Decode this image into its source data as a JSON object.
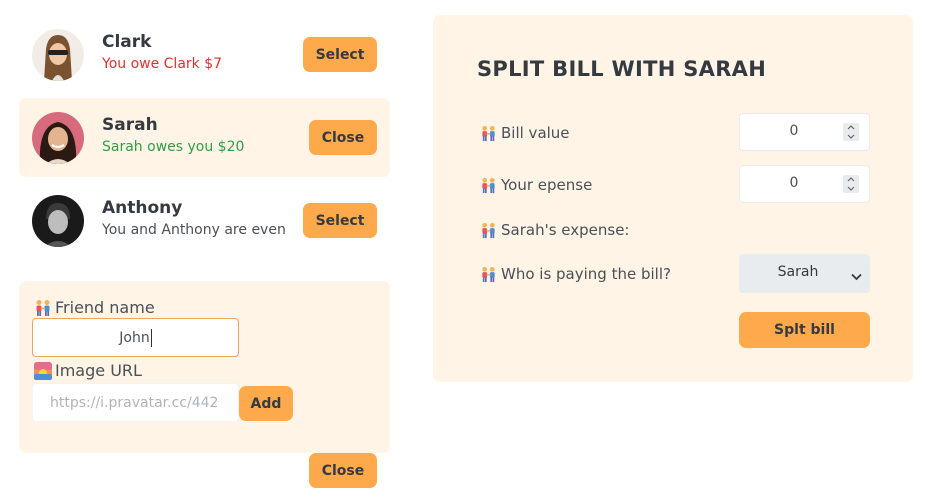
{
  "friends": [
    {
      "name": "Clark",
      "status": "You owe Clark $7",
      "button": "Select"
    },
    {
      "name": "Sarah",
      "status": "Sarah owes you $20",
      "button": "Close"
    },
    {
      "name": "Anthony",
      "status": "You and Anthony are even",
      "button": "Select"
    }
  ],
  "add_form": {
    "name_label": "Friend name",
    "name_value": "John",
    "image_label": "Image URL",
    "image_placeholder": "https://i.pravatar.cc/442",
    "add_button": "Add"
  },
  "close_button": "Close",
  "split": {
    "title": "SPLIT BILL WITH SARAH",
    "bill_label": "Bill value",
    "bill_value": "0",
    "expense_label": "Your epense",
    "expense_value": "0",
    "friend_expense_label": "Sarah's expense:",
    "payer_label": "Who is paying the bill?",
    "payer_value": "Sarah",
    "submit_button": "Splt bill"
  },
  "colors": {
    "accent": "#ffa94d",
    "panel": "#fff4e6",
    "owe": "#e03131",
    "owed": "#2f9e44"
  },
  "icons": [
    "people-holding-hands-icon",
    "sunrise-icon",
    "chevron-down-icon",
    "spinner-arrows-icon"
  ]
}
